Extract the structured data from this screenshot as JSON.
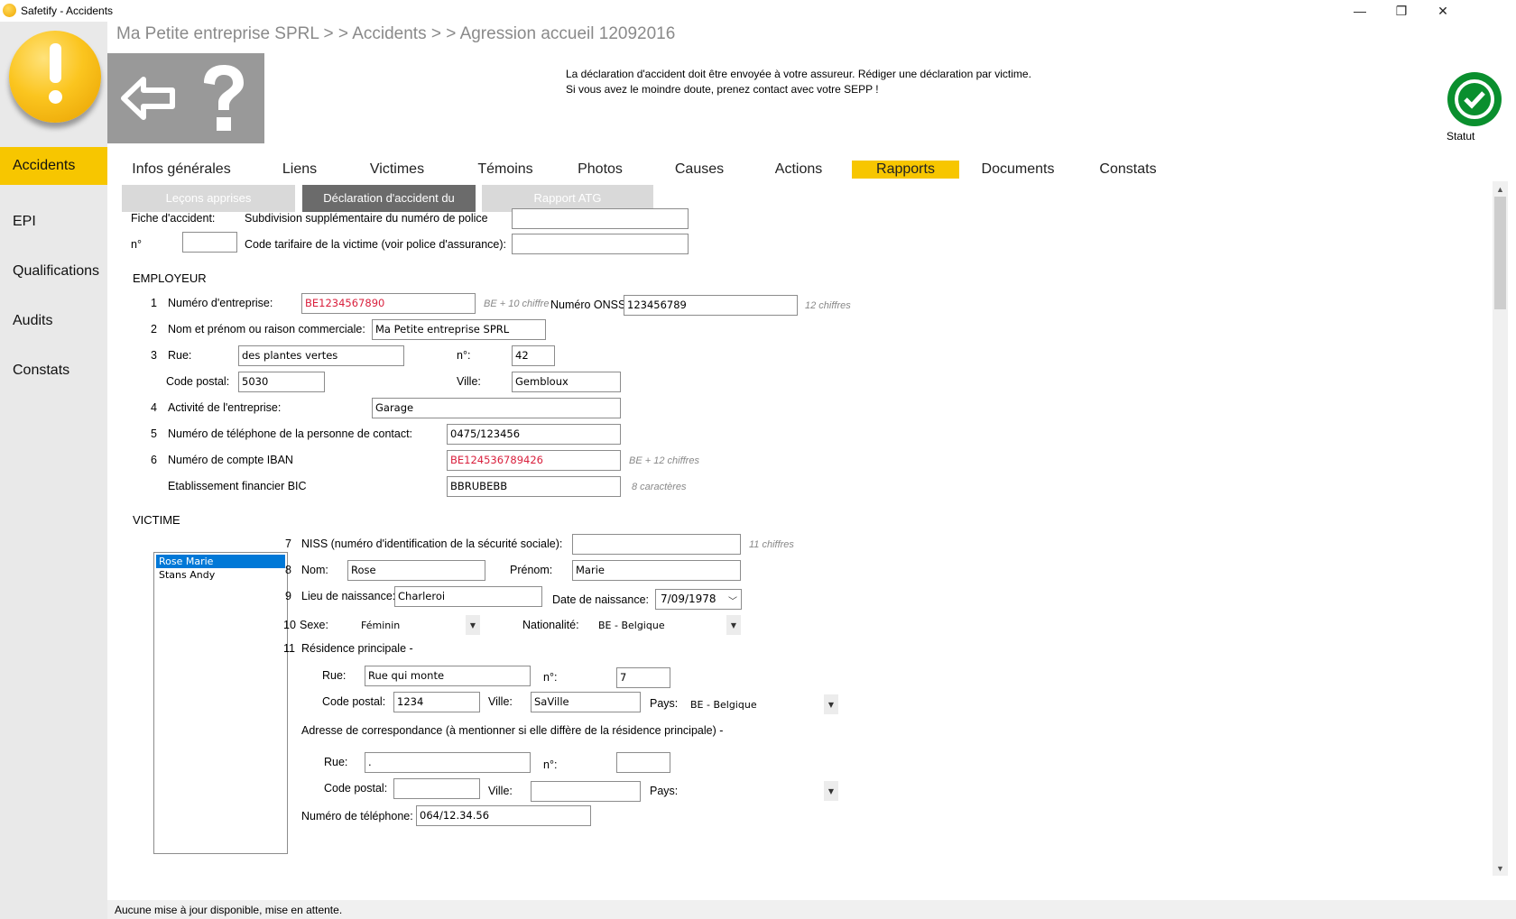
{
  "window": {
    "title": "Safetify - Accidents",
    "minimize_glyph": "—",
    "restore_glyph": "❐",
    "close_glyph": "✕"
  },
  "breadcrumb": "Ma Petite entreprise SPRL  > >  Accidents  > >  Agression accueil 12092016",
  "notice": {
    "line1": "La déclaration d'accident doit être envoyée à votre assureur. Rédiger une déclaration par victime.",
    "line2": "Si vous avez le moindre doute, prenez contact avec votre SEPP !"
  },
  "status": {
    "label": "Statut",
    "icon": "check-circle-icon",
    "color": "#0a8f2e"
  },
  "sidebar": {
    "items": [
      {
        "label": "Accidents",
        "active": true
      },
      {
        "label": "EPI"
      },
      {
        "label": "Qualifications"
      },
      {
        "label": "Audits"
      },
      {
        "label": "Constats"
      }
    ]
  },
  "tabs": [
    "Infos générales",
    "Liens",
    "Victimes",
    "Témoins",
    "Photos",
    "Causes",
    "Actions",
    "Rapports",
    "Documents",
    "Constats"
  ],
  "active_tab": "Rapports",
  "subtabs": [
    "Leçons apprises",
    "Déclaration d'accident du",
    "Rapport ATG"
  ],
  "form": {
    "fiche_label": "Fiche d'accident:",
    "n_label": "n°",
    "subdivision_label": "Subdivision supplémentaire du numéro de police",
    "code_tarifaire_label": "Code tarifaire de la victime (voir police d'assurance):",
    "employeur": {
      "title": "EMPLOYEUR",
      "n1": "1",
      "numero_entreprise_label": "Numéro d'entreprise:",
      "numero_entreprise": "BE1234567890",
      "numero_entreprise_hint": "BE + 10 chiffre",
      "onss_label": "Numéro ONSS:",
      "onss": "123456789",
      "onss_hint": "12 chiffres",
      "n2": "2",
      "nom_label": "Nom et prénom ou raison commerciale:",
      "nom": "Ma Petite entreprise SPRL",
      "n3": "3",
      "rue_label": "Rue:",
      "rue": "des plantes vertes",
      "num_label": "n°:",
      "num": "42",
      "cp_label": "Code postal:",
      "cp": "5030",
      "ville_label": "Ville:",
      "ville": "Gembloux",
      "n4": "4",
      "activite_label": "Activité de l'entreprise:",
      "activite": "Garage",
      "n5": "5",
      "tel_label": "Numéro de téléphone de la personne de contact:",
      "tel": "0475/123456",
      "n6": "6",
      "iban_label": "Numéro de compte IBAN",
      "iban": "BE124536789426",
      "iban_hint": "BE + 12 chiffres",
      "bic_label": "Etablissement financier BIC",
      "bic": "BBRUBEBB",
      "bic_hint": "8 caractères"
    },
    "victime": {
      "title": "VICTIME",
      "list": [
        "Rose Marie",
        "Stans Andy"
      ],
      "n7": "7",
      "niss_label": "NISS (numéro d'identification de la sécurité sociale):",
      "niss": "",
      "niss_hint": "11 chiffres",
      "n8": "8",
      "nom_label": "Nom:",
      "nom": "Rose",
      "prenom_label": "Prénom:",
      "prenom": "Marie",
      "n9": "9",
      "lieu_label": "Lieu de naissance:",
      "lieu": "Charleroi",
      "date_label": "Date de naissance:",
      "date": "7/09/1978",
      "n10": "10",
      "sexe_label": "Sexe:",
      "sexe": "Féminin",
      "nat_label": "Nationalité:",
      "nat": "BE - Belgique",
      "n11": "11",
      "residence_label": "Résidence principale -",
      "res_rue_label": "Rue:",
      "res_rue": "Rue qui monte",
      "res_num_label": "n°:",
      "res_num": "7",
      "res_cp_label": "Code postal:",
      "res_cp": "1234",
      "res_ville_label": "Ville:",
      "res_ville": "SaVille",
      "res_pays_label": "Pays:",
      "res_pays": "BE - Belgique",
      "corr_label": "Adresse de correspondance (à mentionner si elle diffère de la résidence principale) -",
      "corr_rue_label": "Rue:",
      "corr_rue": ".",
      "corr_num_label": "n°:",
      "corr_num": "",
      "corr_cp_label": "Code postal:",
      "corr_cp": "",
      "corr_ville_label": "Ville:",
      "corr_ville": "",
      "corr_pays_label": "Pays:",
      "corr_pays": "",
      "tel_label": "Numéro de téléphone:",
      "tel": "064/12.34.56"
    }
  },
  "statusbar": "Aucune mise à jour disponible, mise en attente."
}
